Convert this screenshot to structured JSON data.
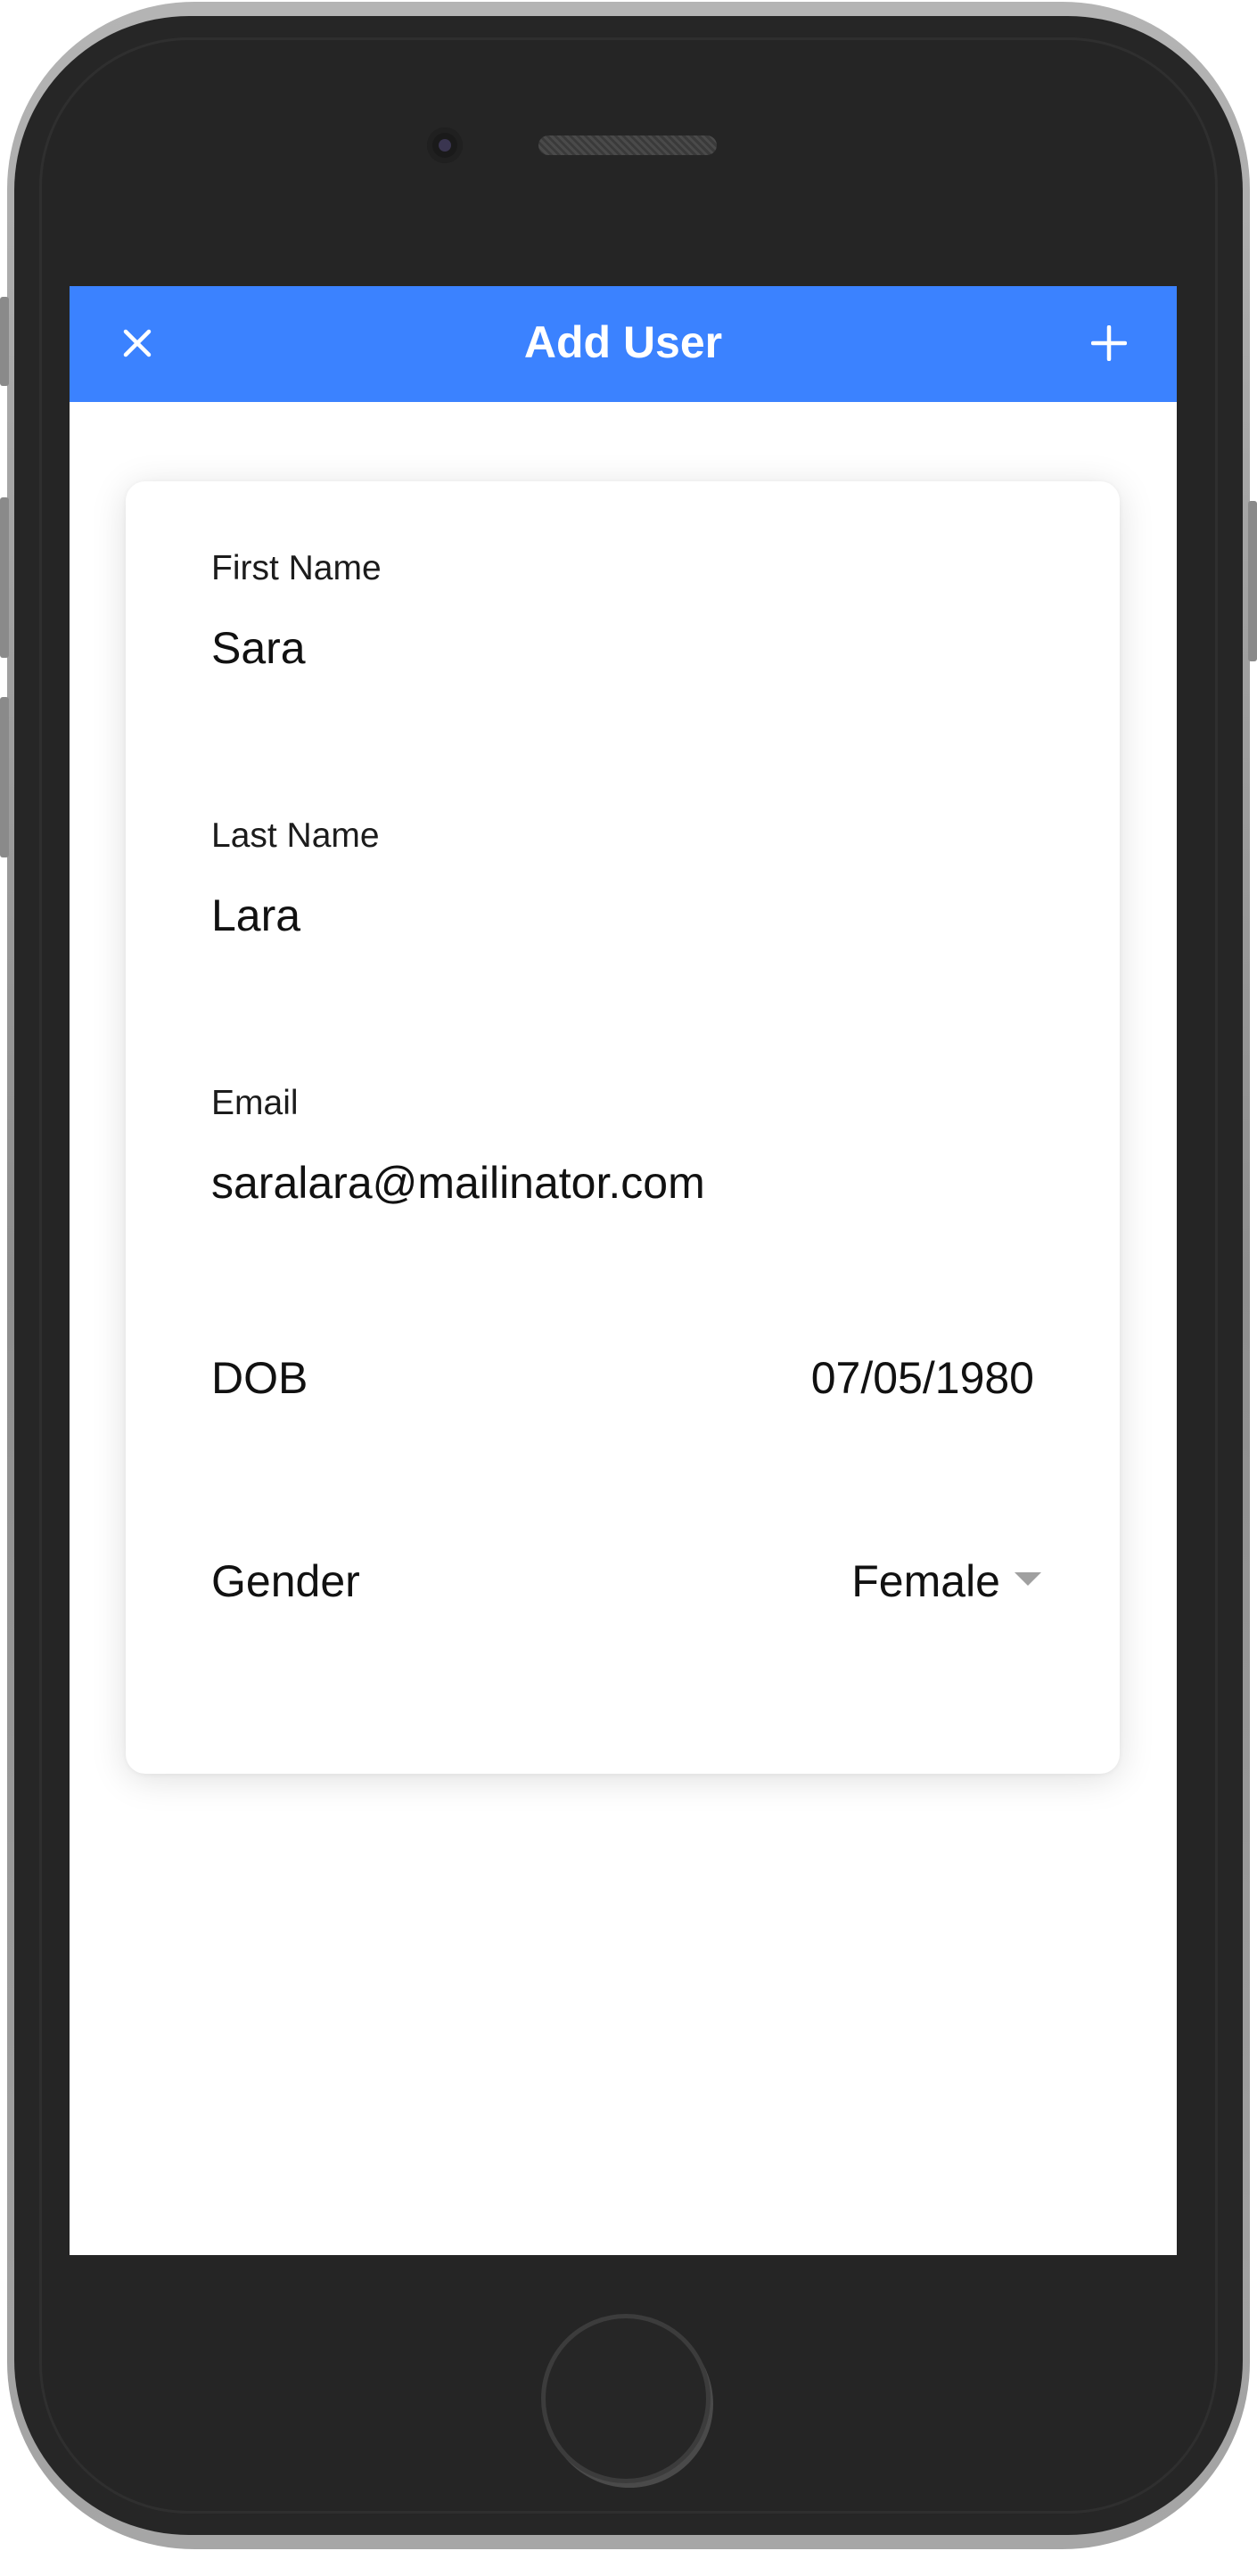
{
  "navbar": {
    "title": "Add User",
    "close_icon": "close-icon",
    "add_icon": "plus-icon",
    "accent_color": "#3b82ff"
  },
  "form": {
    "first_name": {
      "label": "First Name",
      "value": "Sara"
    },
    "last_name": {
      "label": "Last Name",
      "value": "Lara"
    },
    "email": {
      "label": "Email",
      "value": "saralara@mailinator.com"
    },
    "dob": {
      "label": "DOB",
      "value": "07/05/1980"
    },
    "gender": {
      "label": "Gender",
      "value": "Female",
      "icon": "dropdown-caret-icon"
    }
  }
}
